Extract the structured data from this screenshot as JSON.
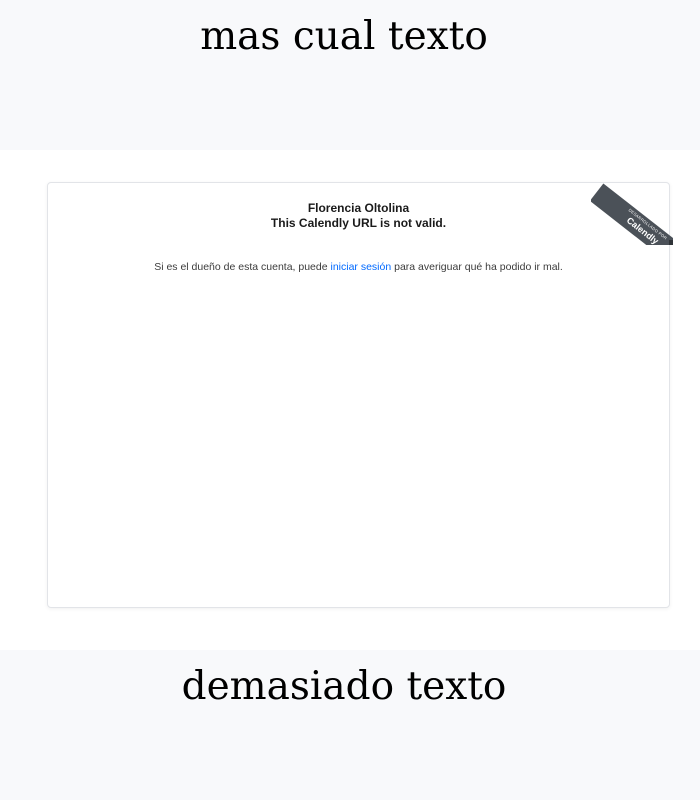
{
  "top": {
    "heading": "mas cual texto"
  },
  "embed": {
    "ribbon": {
      "small_text": "DESARROLLADO POR",
      "brand": "Calendly"
    },
    "owner_name": "Florencia Oltolina",
    "invalid_message": "This Calendly URL is not valid.",
    "note_prefix": "Si es el dueño de esta cuenta, puede ",
    "login_link": "iniciar sesión",
    "note_suffix": " para averiguar qué ha podido ir mal."
  },
  "bottom": {
    "heading": "demasiado texto"
  },
  "colors": {
    "page_background": "#f8f9fb",
    "embed_background": "#ffffff",
    "link": "#0069ff",
    "ribbon": "#4b5158"
  }
}
